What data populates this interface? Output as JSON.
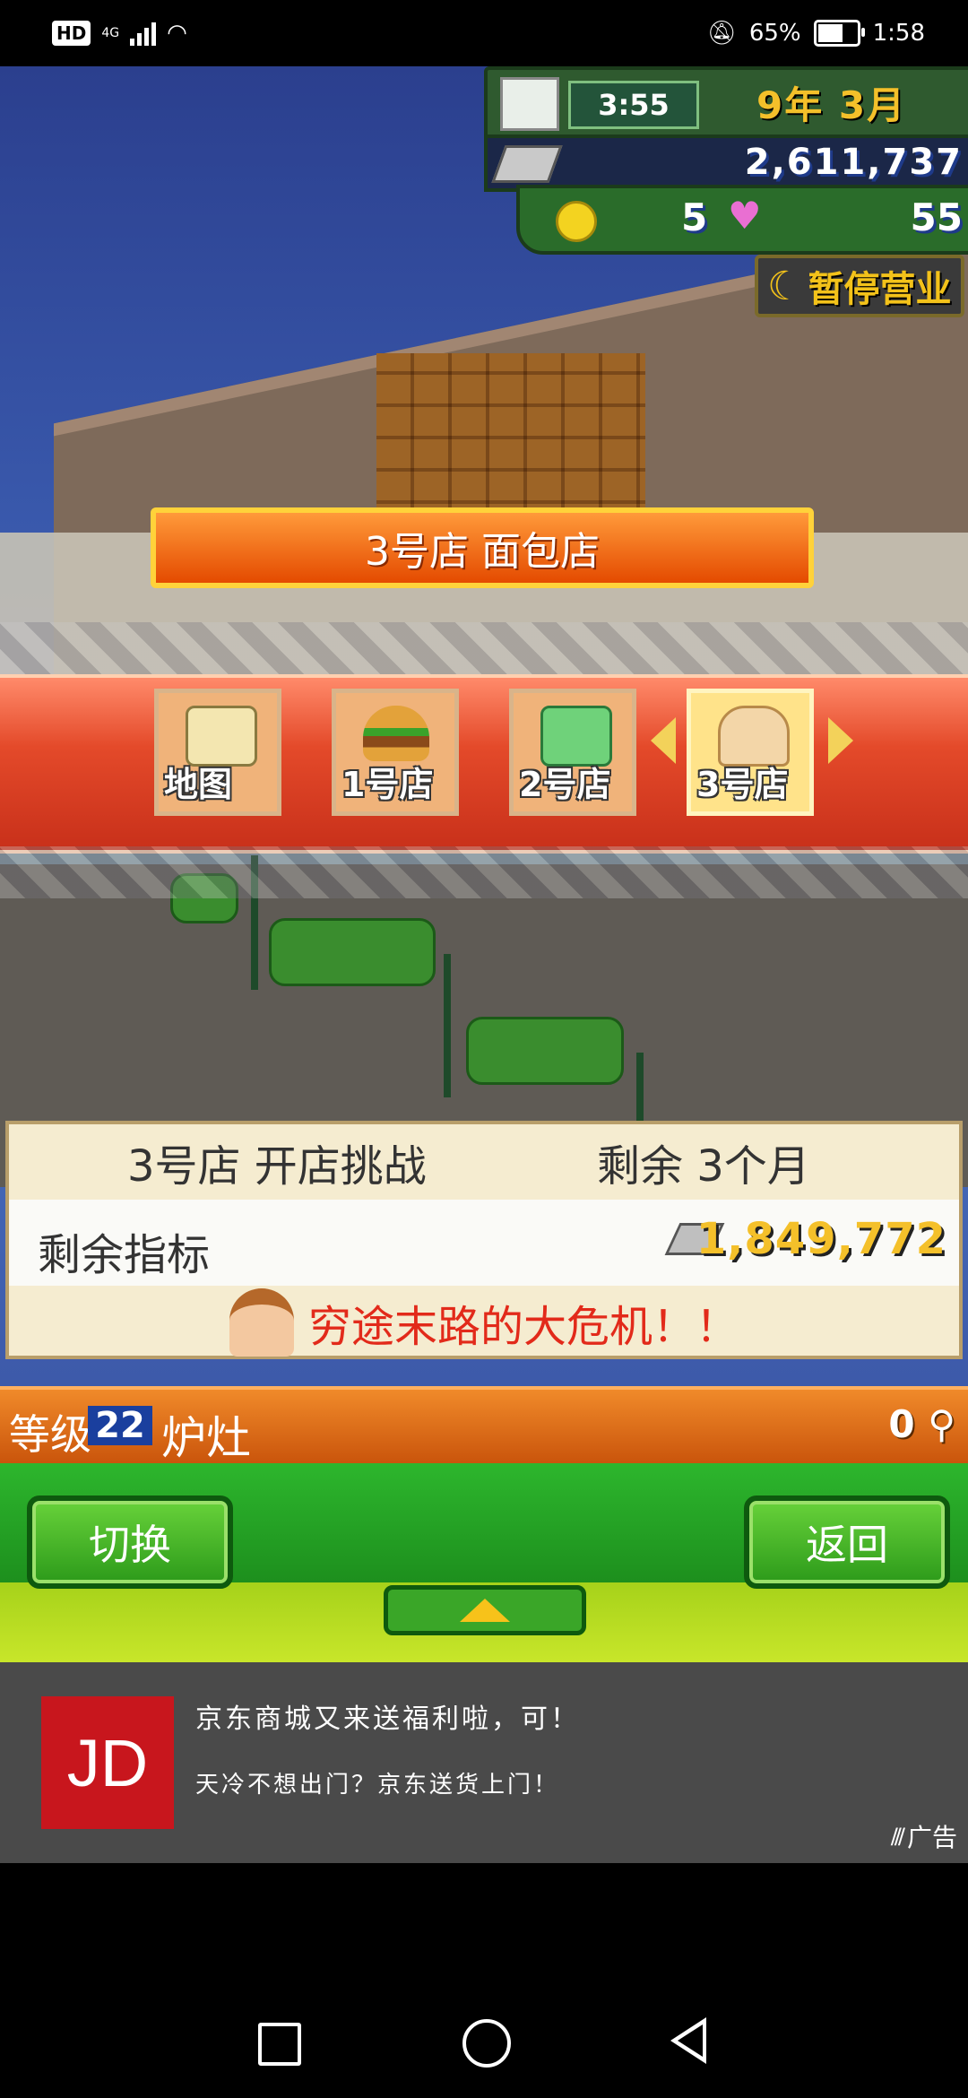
{
  "status_bar": {
    "hd": "HD",
    "network": "4G",
    "battery": "65%",
    "battery_level": 0.65,
    "time": "1:58"
  },
  "hud": {
    "time": "3:55",
    "date": "9年 3月",
    "money": "2,611,737",
    "coins": "5",
    "hearts": "55",
    "pause_label": "暂停营业"
  },
  "shop_banner": "3号店 面包店",
  "shop_tiles": [
    {
      "label": "地图",
      "icon": "map-scroll-icon"
    },
    {
      "label": "1号店",
      "icon": "burger-icon"
    },
    {
      "label": "2号店",
      "icon": "clothing-icon"
    },
    {
      "label": "3号店",
      "icon": "bread-icon",
      "selected": true
    }
  ],
  "challenge": {
    "title": "3号店 开店挑战",
    "remaining": "剩余 3个月",
    "target_label": "剩余指标",
    "target_value": "1,849,772",
    "warning": "穷途末路的大危机！！"
  },
  "level_bar": {
    "level_label": "等级",
    "level": "22",
    "name": "炉灶",
    "count": "0"
  },
  "buttons": {
    "switch": "切换",
    "back": "返回"
  },
  "ad": {
    "logo": "JD",
    "line1": "京东商城又来送福利啦，可！",
    "line2": "天冷不想出门？京东送货上门！",
    "tag": "广告"
  },
  "colors": {
    "accent_orange": "#e44a00",
    "gold": "#f4c02a",
    "green": "#2c9a1a",
    "jd_red": "#c8161d",
    "warning_red": "#e22a1a"
  }
}
